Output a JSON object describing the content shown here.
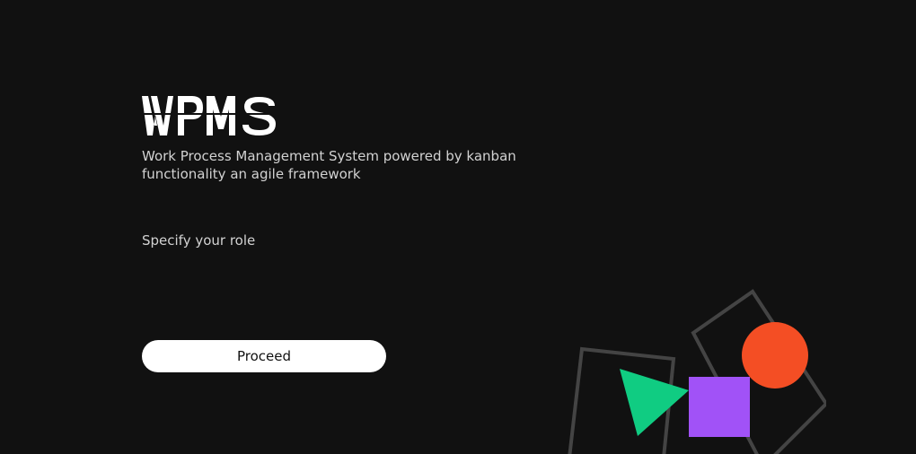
{
  "app": {
    "logo_text": "WPMS",
    "subtitle": "Work Process Management System powered by kanban functionality an agile framework"
  },
  "form": {
    "role_label": "Specify your role",
    "proceed_label": "Proceed"
  },
  "colors": {
    "background": "#111111",
    "text_muted": "#d2d2d2",
    "button_bg": "#ffffff",
    "button_text": "#111111",
    "shape_outline": "#444444",
    "green": "#10cc82",
    "purple": "#a152f7",
    "orange": "#f44e24"
  }
}
